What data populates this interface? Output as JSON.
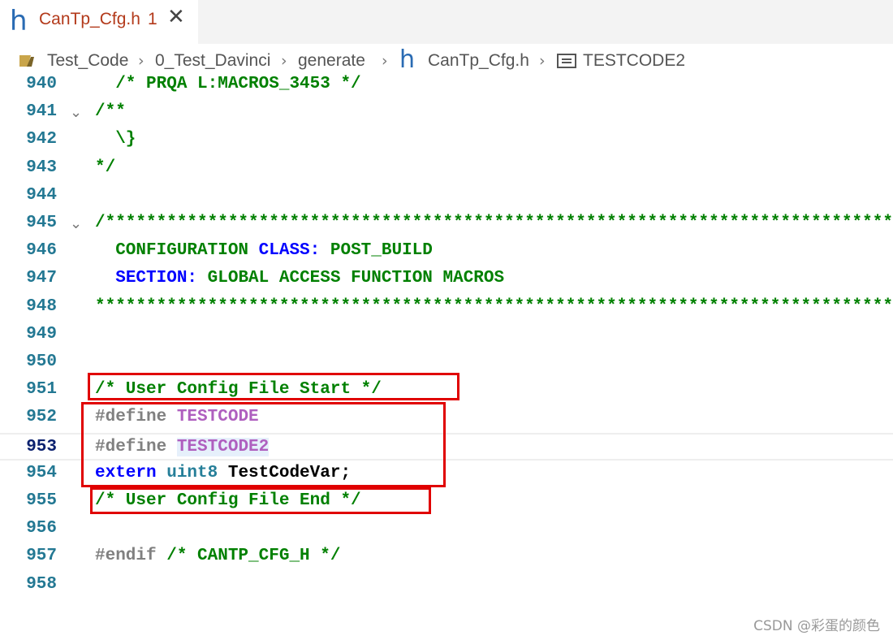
{
  "tab": {
    "icon": "h",
    "filename": "CanTp_Cfg.h",
    "problem_count": "1",
    "close_glyph": "✕"
  },
  "breadcrumb": {
    "items": [
      "Test_Code",
      "0_Test_Davinci",
      "generate",
      "CanTp_Cfg.h",
      "TESTCODE2"
    ],
    "file_icon": "h",
    "separator": "›"
  },
  "editor": {
    "lines": [
      {
        "n": "940",
        "fold": false,
        "parts": [
          {
            "c": "cmt",
            "t": "  /* PRQA L:MACROS_3453 */"
          }
        ]
      },
      {
        "n": "941",
        "fold": true,
        "parts": [
          {
            "c": "cmt",
            "t": "/**"
          }
        ]
      },
      {
        "n": "942",
        "fold": false,
        "parts": [
          {
            "c": "cmt",
            "t": "  \\}"
          }
        ]
      },
      {
        "n": "943",
        "fold": false,
        "parts": [
          {
            "c": "cmt",
            "t": "*/"
          }
        ]
      },
      {
        "n": "944",
        "fold": false,
        "parts": []
      },
      {
        "n": "945",
        "fold": true,
        "parts": [
          {
            "c": "cmt",
            "t": "/******************************************************************************"
          }
        ]
      },
      {
        "n": "946",
        "fold": false,
        "parts": [
          {
            "c": "cmt",
            "t": "  CONFIGURATION "
          },
          {
            "c": "blue",
            "t": "CLASS:"
          },
          {
            "c": "cmt",
            "t": " POST_BUILD"
          }
        ]
      },
      {
        "n": "947",
        "fold": false,
        "parts": [
          {
            "c": "cmt",
            "t": "  "
          },
          {
            "c": "blue",
            "t": "SECTION:"
          },
          {
            "c": "cmt",
            "t": " GLOBAL ACCESS FUNCTION MACROS"
          }
        ]
      },
      {
        "n": "948",
        "fold": false,
        "parts": [
          {
            "c": "cmt",
            "t": "******************************************************************************"
          }
        ]
      },
      {
        "n": "949",
        "fold": false,
        "parts": []
      },
      {
        "n": "950",
        "fold": false,
        "parts": []
      },
      {
        "n": "951",
        "fold": false,
        "parts": [
          {
            "c": "cmt",
            "t": "/* User Config File Start */"
          }
        ]
      },
      {
        "n": "952",
        "fold": false,
        "parts": [
          {
            "c": "pre",
            "t": "#define "
          },
          {
            "c": "mac",
            "t": "TESTCODE"
          }
        ]
      },
      {
        "n": "953",
        "fold": false,
        "current": true,
        "parts": [
          {
            "c": "pre",
            "t": "#define "
          },
          {
            "c": "mac",
            "t": "TESTCODE2"
          }
        ]
      },
      {
        "n": "954",
        "fold": false,
        "parts": [
          {
            "c": "blue",
            "t": "extern "
          },
          {
            "c": "typ",
            "t": "uint8 "
          },
          {
            "c": "txt",
            "t": "TestCodeVar;"
          }
        ]
      },
      {
        "n": "955",
        "fold": false,
        "parts": [
          {
            "c": "cmt",
            "t": "/* User Config File End */"
          }
        ]
      },
      {
        "n": "956",
        "fold": false,
        "parts": []
      },
      {
        "n": "957",
        "fold": false,
        "parts": [
          {
            "c": "pre",
            "t": "#endif "
          },
          {
            "c": "cmt",
            "t": "/* CANTP_CFG_H */"
          }
        ]
      },
      {
        "n": "958",
        "fold": false,
        "parts": []
      }
    ]
  },
  "watermark": "CSDN @彩蛋的颜色",
  "colors": {
    "comment": "#008000",
    "keyword": "#0000ff",
    "macro": "#af5fbf",
    "type": "#267f99",
    "line_number": "#237893",
    "highlight_box": "#e00000"
  }
}
